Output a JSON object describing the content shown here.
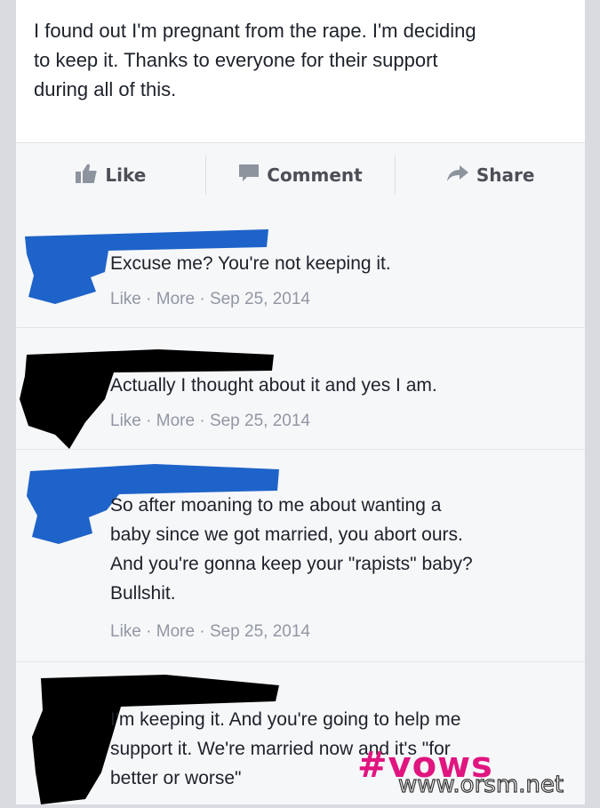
{
  "post": {
    "lines": [
      "I found out I'm pregnant from the rape. I'm deciding",
      "to keep it. Thanks to everyone for their support",
      "during all of this."
    ]
  },
  "actions": {
    "like_label": "Like",
    "comment_label": "Comment",
    "share_label": "Share",
    "like_icon": "thumbs-up-icon",
    "comment_icon": "speech-bubble-icon",
    "share_icon": "share-arrow-icon"
  },
  "comments": [
    {
      "lines": [
        "Excuse me? You're not keeping it."
      ],
      "like": "Like",
      "more": "More",
      "date": "Sep 25, 2014",
      "redaction_color": "#1e63c9"
    },
    {
      "lines": [
        "Actually I thought about it and yes I am."
      ],
      "like": "Like",
      "more": "More",
      "date": "Sep 25, 2014",
      "redaction_color": "#000000"
    },
    {
      "lines": [
        "So after moaning to me about wanting a",
        "baby since we got married, you abort ours.",
        "And you're gonna keep your \"rapists\" baby?",
        "Bullshit."
      ],
      "like": "Like",
      "more": "More",
      "date": "Sep 25, 2014",
      "redaction_color": "#1e63c9"
    },
    {
      "lines": [
        "I'm keeping it. And you're going to help me",
        "support it. We're married now and it's \"for",
        "better or worse\""
      ],
      "redaction_color": "#000000"
    }
  ],
  "watermark": {
    "hashtag": "#vows",
    "site": "www.orsm.net",
    "hashtag_color": "#e0157f"
  },
  "separator": "·"
}
